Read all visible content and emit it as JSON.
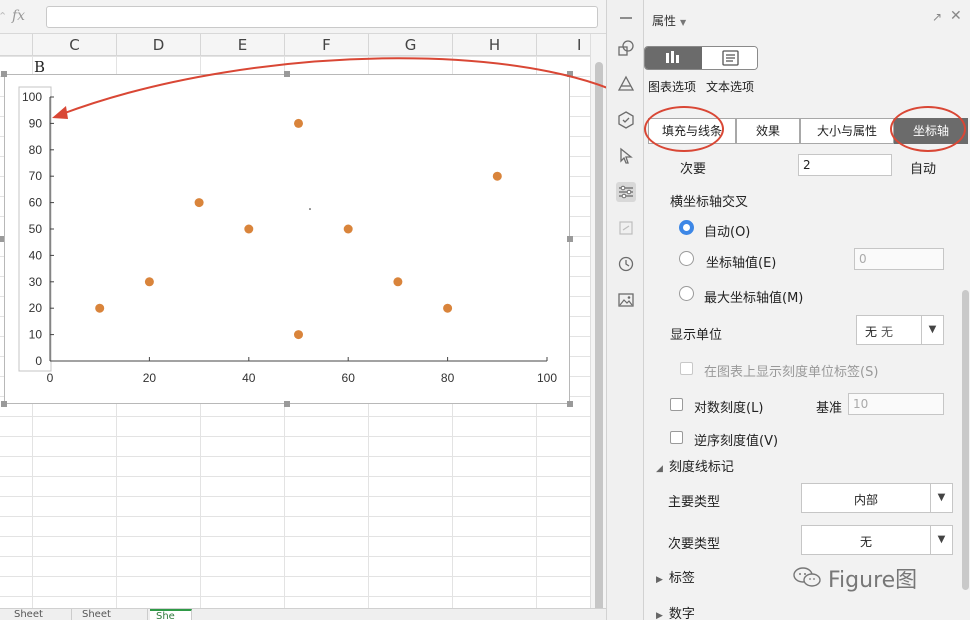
{
  "formula_bar": {
    "fx_label": "fx",
    "value": ""
  },
  "spreadsheet": {
    "columns": [
      "C",
      "D",
      "E",
      "F",
      "G",
      "H",
      "I"
    ],
    "cell_text": "B",
    "sheet_tabs": [
      "Sheet",
      "Sheet",
      "She"
    ]
  },
  "chart_data": {
    "type": "scatter",
    "x": [
      10,
      20,
      30,
      40,
      50,
      50,
      60,
      70,
      80,
      90
    ],
    "y": [
      20,
      30,
      60,
      50,
      10,
      90,
      50,
      30,
      20,
      70
    ],
    "xlim": [
      0,
      100
    ],
    "ylim": [
      0,
      100
    ],
    "xticks": [
      "0",
      "20",
      "40",
      "60",
      "80",
      "100"
    ],
    "yticks": [
      "0",
      "10",
      "20",
      "30",
      "40",
      "50",
      "60",
      "70",
      "80",
      "90",
      "100"
    ],
    "marker_color": "#d9843b",
    "grid": false,
    "title": "",
    "xlabel": "",
    "ylabel": ""
  },
  "annotation_color": "#d94735",
  "panel": {
    "title": "属性",
    "chart_options_label": "图表选项",
    "text_options_label": "文本选项",
    "tabs": [
      "填充与线条",
      "效果",
      "大小与属性",
      "坐标轴"
    ],
    "minor_label": "次要",
    "minor_value": "2",
    "minor_auto": "自动",
    "cross_heading": "横坐标轴交叉",
    "radio_auto": "自动(O)",
    "radio_axis_value": "坐标轴值(E)",
    "axis_value_field": "0",
    "radio_max": "最大坐标轴值(M)",
    "display_unit_label": "显示单位",
    "display_unit_value": "无",
    "show_unit_label": "在图表上显示刻度单位标签(S)",
    "log_scale_label": "对数刻度(L)",
    "base_label": "基准",
    "base_value": "10",
    "reverse_label": "逆序刻度值(V)",
    "tick_marks_heading": "刻度线标记",
    "major_type_label": "主要类型",
    "major_type_value": "内部",
    "minor_type_label": "次要类型",
    "minor_type_value": "无",
    "labels_heading": "标签",
    "number_heading": "数字"
  },
  "watermark": "Figure图"
}
